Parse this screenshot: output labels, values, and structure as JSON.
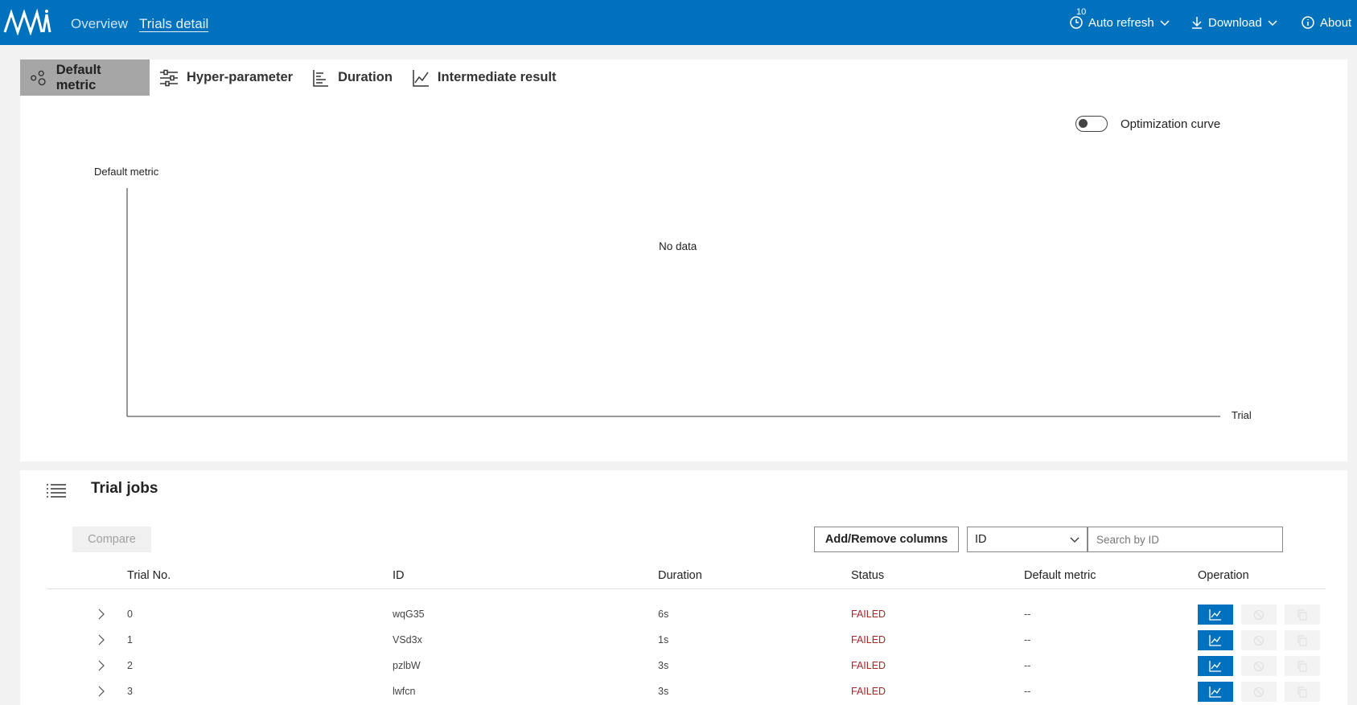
{
  "header": {
    "nav": [
      {
        "label": "Overview",
        "active": false
      },
      {
        "label": "Trials detail",
        "active": true
      }
    ],
    "refresh_interval": "10",
    "auto_refresh_label": "Auto refresh",
    "download_label": "Download",
    "about_label": "About",
    "brand_color": "#0071bc"
  },
  "chart_panel": {
    "tabs": [
      {
        "label": "Default metric",
        "icon": "scatter-icon",
        "active": true
      },
      {
        "label": "Hyper-parameter",
        "icon": "sliders-icon",
        "active": false
      },
      {
        "label": "Duration",
        "icon": "bar-chart-icon",
        "active": false
      },
      {
        "label": "Intermediate result",
        "icon": "line-chart-icon",
        "active": false
      }
    ],
    "toggle_label": "Optimization curve",
    "toggle_on": false
  },
  "chart_data": {
    "type": "scatter",
    "series": [],
    "ylabel": "Default metric",
    "xlabel": "Trial",
    "empty_message": "No data",
    "grid": false
  },
  "trial_jobs": {
    "title": "Trial jobs",
    "compare_label": "Compare",
    "add_remove_label": "Add/Remove columns",
    "filter_select_value": "ID",
    "search_placeholder": "Search by ID",
    "columns": [
      "Trial No.",
      "ID",
      "Duration",
      "Status",
      "Default metric",
      "Operation"
    ],
    "rows": [
      {
        "no": "0",
        "id": "wqG35",
        "duration": "6s",
        "status": "FAILED",
        "metric": "--"
      },
      {
        "no": "1",
        "id": "VSd3x",
        "duration": "1s",
        "status": "FAILED",
        "metric": "--"
      },
      {
        "no": "2",
        "id": "pzlbW",
        "duration": "3s",
        "status": "FAILED",
        "metric": "--"
      },
      {
        "no": "3",
        "id": "lwfcn",
        "duration": "3s",
        "status": "FAILED",
        "metric": "--"
      }
    ],
    "status_color": "#a4262c"
  }
}
